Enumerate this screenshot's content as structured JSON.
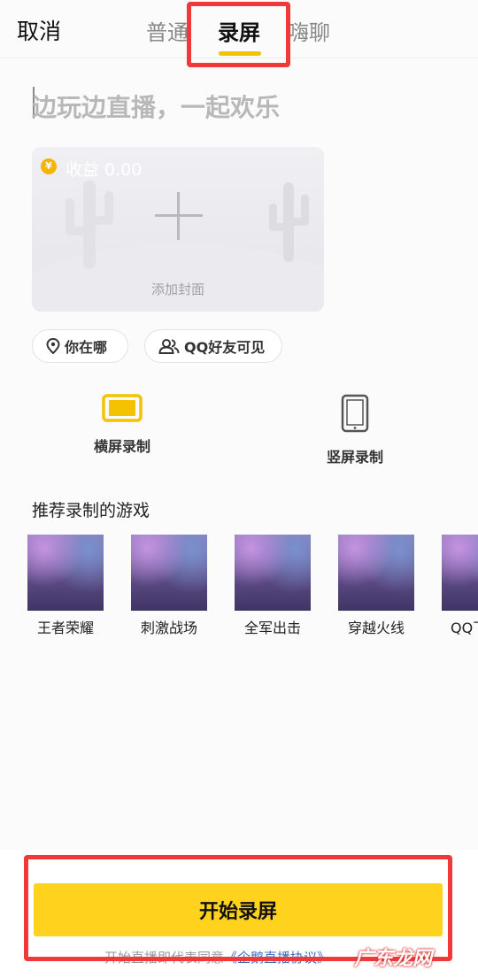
{
  "header": {
    "cancel_label": "取消",
    "tabs": [
      {
        "label": "普通",
        "selected": false
      },
      {
        "label": "录屏",
        "selected": true
      },
      {
        "label": "嗨聊",
        "selected": false
      }
    ]
  },
  "title_input": {
    "placeholder": "边玩边直播，一起欢乐"
  },
  "cover": {
    "earnings_label": "收益 0.00",
    "coin_symbol": "¥",
    "add_cover_label": "添加封面"
  },
  "chips": {
    "location": "你在哪",
    "visibility": "QQ好友可见"
  },
  "orientation": {
    "landscape": "横屏录制",
    "portrait": "竖屏录制"
  },
  "games": {
    "title": "推荐录制的游戏",
    "items": [
      "王者荣耀",
      "刺激战场",
      "全军出击",
      "穿越火线",
      "QQ飞车"
    ]
  },
  "bottom": {
    "start_label": "开始录屏",
    "agreement_prefix": "开始直播即代表同意",
    "agreement_link": "《企鹅直播协议》"
  },
  "watermark": "广东龙网",
  "colors": {
    "accent": "#f5c200",
    "button": "#ffd21e",
    "highlight": "#f03a3a"
  }
}
